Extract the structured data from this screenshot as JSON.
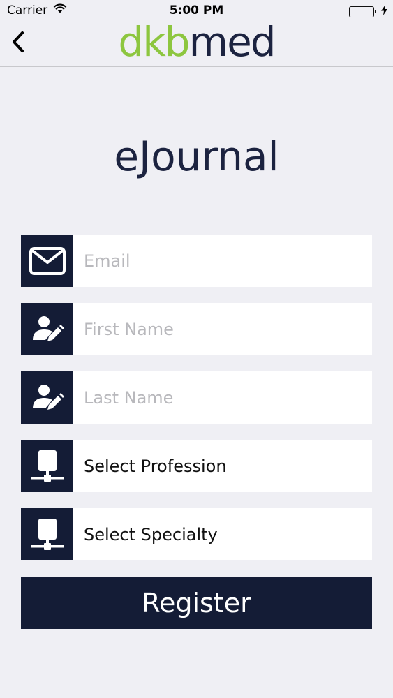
{
  "status_bar": {
    "carrier": "Carrier",
    "time": "5:00 PM",
    "icons": [
      "wifi-icon",
      "battery-icon",
      "charging-bolt-icon"
    ]
  },
  "nav": {
    "back_icon": "chevron-left-icon",
    "logo_part_a": "dkb",
    "logo_part_b": "med",
    "logo_colors": {
      "part_a": "#8dc63f",
      "part_b": "#1c2340"
    }
  },
  "page": {
    "title": "eJournal"
  },
  "form": {
    "email": {
      "placeholder": "Email",
      "value": "",
      "icon": "envelope-icon"
    },
    "first_name": {
      "placeholder": "First Name",
      "value": "",
      "icon": "user-edit-icon"
    },
    "last_name": {
      "placeholder": "Last Name",
      "value": "",
      "icon": "user-edit-icon"
    },
    "profession": {
      "label": "Select Profession",
      "icon": "network-icon"
    },
    "specialty": {
      "label": "Select Specialty",
      "icon": "network-icon"
    },
    "register_label": "Register"
  },
  "colors": {
    "background": "#efeff4",
    "accent_dark": "#141c36",
    "battery": "#4cd964"
  }
}
